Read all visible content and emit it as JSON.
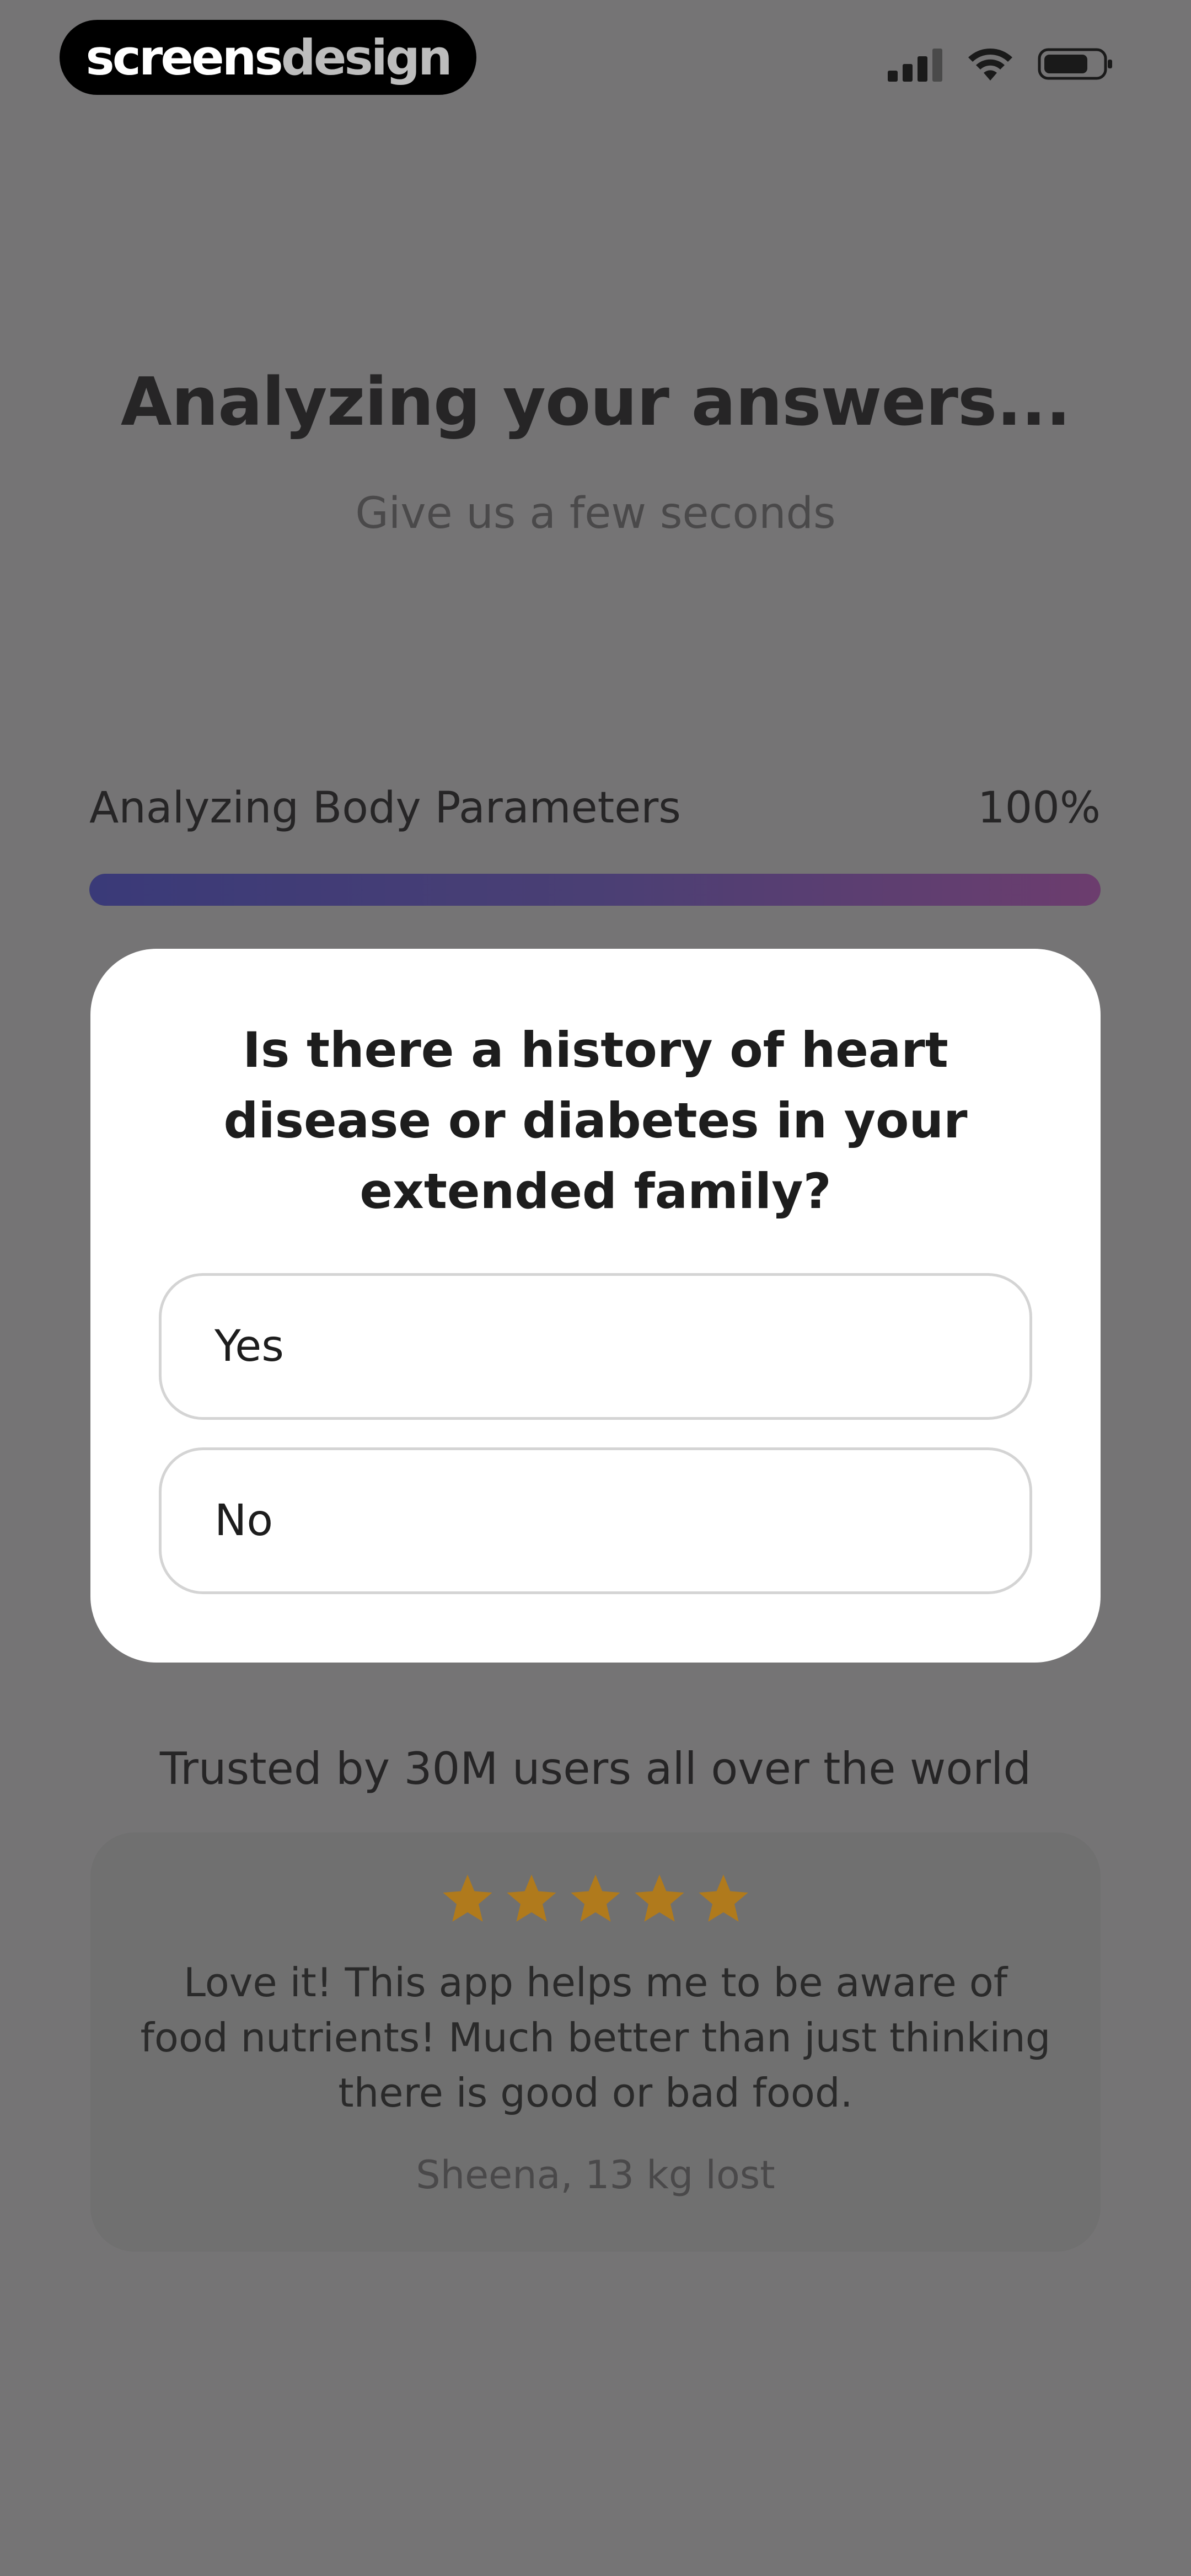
{
  "brand": {
    "part1": "screens",
    "part2": "design"
  },
  "header": {
    "title": "Analyzing your answers...",
    "subtitle": "Give us a few seconds"
  },
  "progress": {
    "label": "Analyzing Body Parameters",
    "value_text": "100%",
    "fraction": 1.0,
    "gradient_colors": [
      "#3a3a78",
      "#6c3d6e"
    ]
  },
  "modal": {
    "question": "Is there a history of heart disease or diabetes in your extended family?",
    "options": [
      {
        "label": "Yes"
      },
      {
        "label": "No"
      }
    ]
  },
  "trust": {
    "text": "Trusted by 30M users all over the world"
  },
  "review": {
    "rating": 5,
    "star_color": "#b07a1c",
    "text": "Love it! This app helps me to be aware of food nutrients! Much better than just thinking there is good or bad food.",
    "author": "Sheena, 13 kg lost"
  },
  "status_icons": [
    "signal-icon",
    "wifi-icon",
    "battery-icon"
  ]
}
